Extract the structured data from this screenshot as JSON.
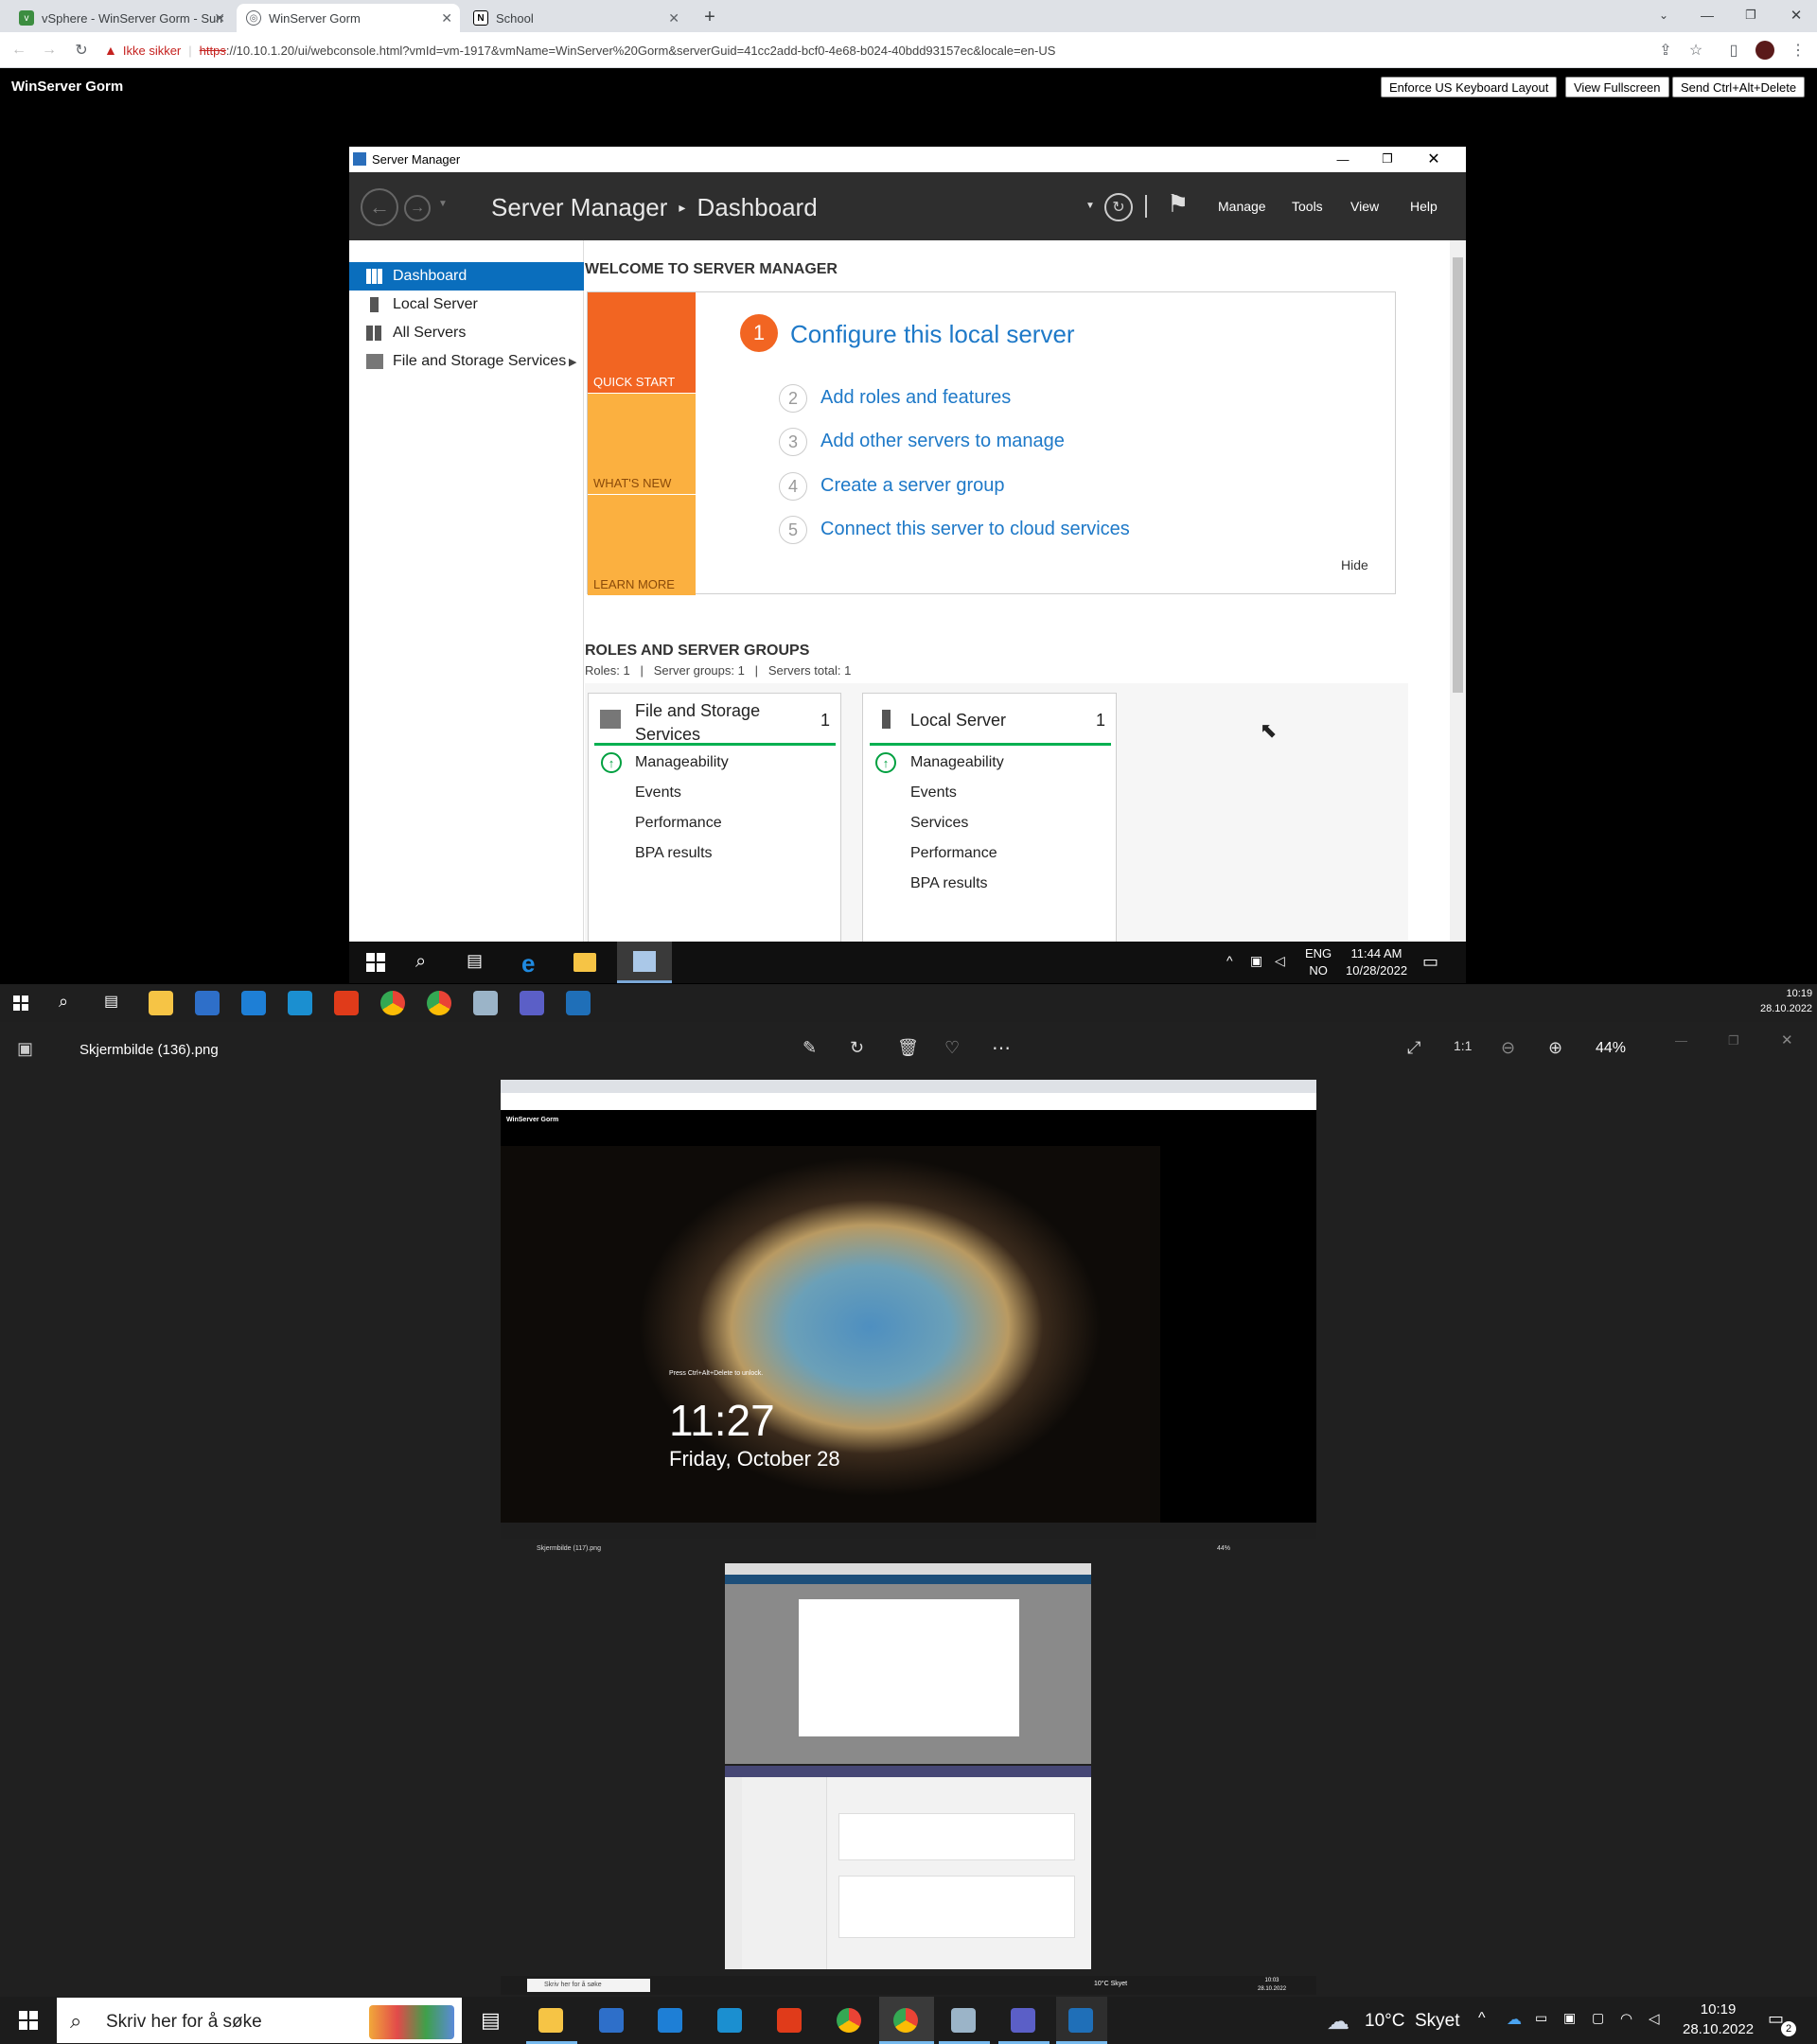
{
  "browser": {
    "tabs": [
      {
        "label": "vSphere - WinServer Gorm - Sum",
        "active": false
      },
      {
        "label": "WinServer Gorm",
        "active": true
      },
      {
        "label": "School",
        "active": false
      }
    ],
    "security_label": "Ikke sikker",
    "url_scheme": "https",
    "url_rest": "://10.10.1.20/ui/webconsole.html?vmId=vm-1917&vmName=WinServer%20Gorm&serverGuid=41cc2add-bcf0-4e68-b024-40bdd93157ec&locale=en-US"
  },
  "console": {
    "vm_name": "WinServer Gorm",
    "buttons": {
      "keyboard": "Enforce US Keyboard Layout",
      "fullscreen": "View Fullscreen",
      "cad": "Send Ctrl+Alt+Delete"
    }
  },
  "server_manager": {
    "window_title": "Server Manager",
    "breadcrumb_app": "Server Manager",
    "breadcrumb_sep": "▸",
    "breadcrumb_page": "Dashboard",
    "menu": {
      "manage": "Manage",
      "tools": "Tools",
      "view": "View",
      "help": "Help"
    },
    "nav": [
      {
        "label": "Dashboard"
      },
      {
        "label": "Local Server"
      },
      {
        "label": "All Servers"
      },
      {
        "label": "File and Storage Services"
      }
    ],
    "welcome_title": "WELCOME TO SERVER MANAGER",
    "tiles": {
      "quick_start": "QUICK START",
      "whats_new": "WHAT'S NEW",
      "learn_more": "LEARN MORE"
    },
    "step1_num": "1",
    "step1_label": "Configure this local server",
    "steps": [
      {
        "num": "2",
        "label": "Add roles and features"
      },
      {
        "num": "3",
        "label": "Add other servers to manage"
      },
      {
        "num": "4",
        "label": "Create a server group"
      },
      {
        "num": "5",
        "label": "Connect this server to cloud services"
      }
    ],
    "hide": "Hide",
    "roles_title": "ROLES AND SERVER GROUPS",
    "roles_summary": "Roles: 1   |   Server groups: 1   |   Servers total: 1",
    "cards": [
      {
        "title1": "File and Storage",
        "title2": "Services",
        "count": "1",
        "rows": [
          "Manageability",
          "Events",
          "Performance",
          "BPA results"
        ]
      },
      {
        "title1": "Local Server",
        "title2": "",
        "count": "1",
        "rows": [
          "Manageability",
          "Events",
          "Services",
          "Performance",
          "BPA results"
        ]
      }
    ]
  },
  "guest_taskbar": {
    "lang": "ENG",
    "layout": "NO",
    "time": "11:44 AM",
    "date": "10/28/2022"
  },
  "host_taskbar_top": {
    "time": "10:19",
    "date": "28.10.2022"
  },
  "photos": {
    "filename": "Skjermbilde (136).png",
    "zoom": "44%",
    "nested": {
      "vm_name": "WinServer Gorm",
      "lock_hint": "Press Ctrl+Alt+Delete to unlock.",
      "lock_time": "11:27",
      "lock_date": "Friday, October 28",
      "filename": "Skjermbilde (117).png",
      "zoom": "44%",
      "search": "Skriv her for å søke",
      "weather": "10°C Skyet",
      "time": "10:03",
      "date": "28.10.2022"
    }
  },
  "host_taskbar": {
    "search_placeholder": "Skriv her for å søke",
    "weather": "10°C  Skyet",
    "time": "10:19",
    "date": "28.10.2022",
    "notification_count": "2"
  }
}
